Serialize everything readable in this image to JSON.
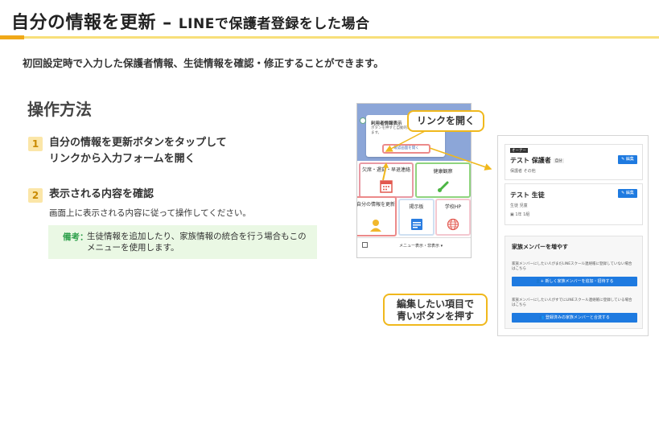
{
  "header": {
    "title_main": "自分の情報を更新",
    "title_dash": " – ",
    "title_sub": "LINEで保護者登録をした場合"
  },
  "intro": "初回設定時で入力した保護者情報、生徒情報を確認・修正することができます。",
  "section_title": "操作方法",
  "steps": [
    {
      "number": "1",
      "line1": "自分の情報を更新ボタンをタップして",
      "line2": "リンクから入力フォームを開く"
    },
    {
      "number": "2",
      "line1": "表示される内容を確認",
      "desc": "画面上に表示される内容に従って操作してください。"
    }
  ],
  "note": {
    "label": "備考：",
    "line1": "生徒情報を追加したり、家族情報の統合を行う場合もこの",
    "line2": "メニューを使用します。"
  },
  "phone": {
    "popup_title": "利用者情報表示",
    "popup_text1": "ボタンを押すと自動的に",
    "popup_text2": "ます。",
    "popup_button": "確認画面を開く",
    "tiles": [
      "欠席・遅刻・早退連絡",
      "健康観察",
      "自分の情報を更新",
      "掲示板",
      "学校HP"
    ],
    "menu_label": "メニュー表示・非表示 ▾"
  },
  "callouts": {
    "open_link": "リンクを開く",
    "press_blue_line1": "編集したい項目で",
    "press_blue_line2": "青いボタンを押す"
  },
  "panel": {
    "owner_tag": "オーナー",
    "guardian_name": "テスト 保護者",
    "guardian_badge": "自分",
    "guardian_relation": "保護者 その他",
    "student_name": "テスト 生徒",
    "student_type": "生徒 児童",
    "student_class": "1年 1組",
    "edit_label": "編集",
    "family_title": "家族メンバーを増やす",
    "family_note1_a": "家族メンバーにしたい人がまだLINEスクール連絡帳に登録していない場合",
    "family_note1_b": "はこちら",
    "family_btn1": "新しく家族メンバーを追加・招待する",
    "family_note2_a": "家族メンバーにしたい人がすでにLINEスクール連絡帳に登録している場合",
    "family_note2_b": "はこちら",
    "family_btn2": "登録済みの家族メンバーと合流する"
  },
  "colors": {
    "accent_orange": "#f0a818",
    "accent_yellow": "#f8df7a",
    "callout_border": "#f0b81c",
    "note_bg": "#eaf8e4",
    "note_label": "#2d9f4a",
    "edit_blue": "#1e7ae0",
    "highlight_red": "#ec8a8a"
  }
}
